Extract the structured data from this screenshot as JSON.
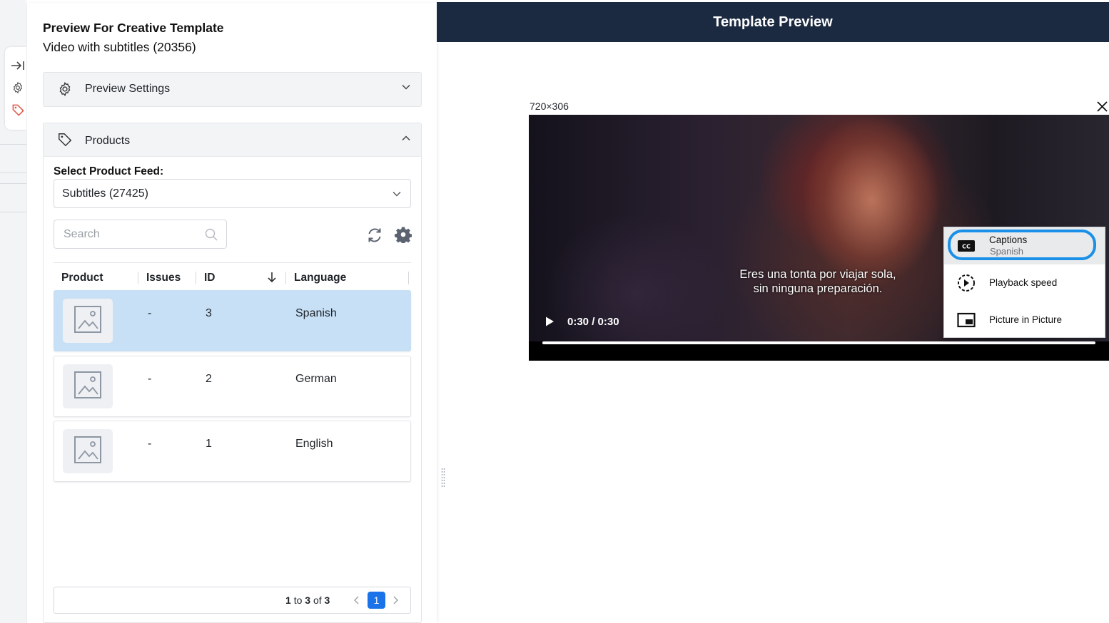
{
  "panel": {
    "title": "Preview For Creative Template",
    "subtitle": "Video with subtitles (20356)"
  },
  "preview_settings": {
    "label": "Preview Settings"
  },
  "products": {
    "label": "Products",
    "feed_label": "Select Product Feed:",
    "feed_value": "Subtitles (27425)",
    "search_placeholder": "Search",
    "columns": [
      "Product",
      "Issues",
      "ID",
      "Language"
    ],
    "rows": [
      {
        "issues": "-",
        "id": "3",
        "language": "Spanish",
        "selected": true
      },
      {
        "issues": "-",
        "id": "2",
        "language": "German",
        "selected": false
      },
      {
        "issues": "-",
        "id": "1",
        "language": "English",
        "selected": false
      }
    ],
    "pagination": {
      "from": "1",
      "to_word": "to",
      "to": "3",
      "of_word": "of",
      "total": "3",
      "current_page": "1"
    }
  },
  "preview": {
    "title": "Template Preview",
    "dimensions": "720×306",
    "video": {
      "subtitle_line1": "Eres una tonta por viajar sola,",
      "subtitle_line2": "sin ninguna preparación.",
      "time": "0:30 / 0:30",
      "progress": 1.0
    },
    "menu": {
      "captions_label": "Captions",
      "captions_value": "Spanish",
      "speed_label": "Playback speed",
      "pip_label": "Picture in Picture"
    }
  },
  "colors": {
    "header_bg": "#1c2a41",
    "selected_row": "#c7e0f6",
    "accent": "#1a73e8",
    "focus_ring": "#1a90e8",
    "tag_icon": "#e05a4a"
  }
}
